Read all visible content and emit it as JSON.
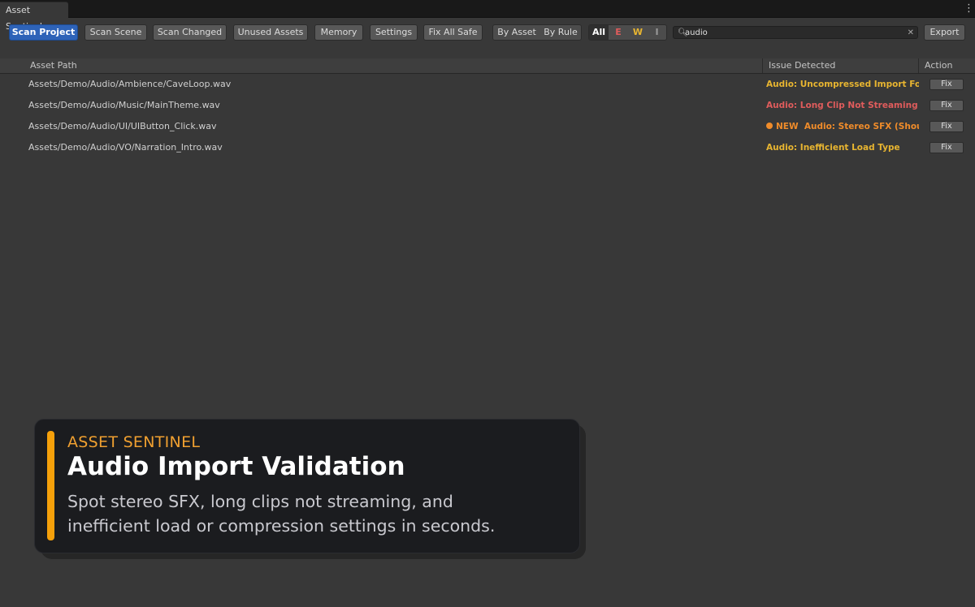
{
  "window": {
    "tab_title": "Asset Sentinel",
    "menu_icon": "kebab-menu-icon"
  },
  "toolbar": {
    "buttons": [
      {
        "label": "Scan Project",
        "active": true
      },
      {
        "label": "Scan Scene"
      },
      {
        "label": "Scan Changed"
      },
      {
        "label": "Unused Assets"
      },
      {
        "label": "Memory"
      },
      {
        "label": "Settings"
      },
      {
        "label": "Fix All Safe"
      }
    ],
    "grouping": [
      "By Asset",
      "By Rule"
    ],
    "severity": [
      "All",
      "E",
      "W",
      "I"
    ],
    "search": {
      "value": "audio",
      "icon": "search-icon",
      "clear_icon": "close-icon"
    },
    "export_label": "Export"
  },
  "table": {
    "columns": [
      "Asset Path",
      "Issue Detected",
      "Action"
    ],
    "rows": [
      {
        "path": "Assets/Demo/Audio/Ambience/CaveLoop.wav",
        "issue": "Audio: Uncompressed Import Format",
        "color": "#e8b530",
        "action": "Fix"
      },
      {
        "path": "Assets/Demo/Audio/Music/MainTheme.wav",
        "issue": "Audio: Long Clip Not Streaming",
        "color": "#e05c5c",
        "action": "Fix"
      },
      {
        "path": "Assets/Demo/Audio/UI/UIButton_Click.wav",
        "badge": "NEW",
        "issue": "Audio: Stereo SFX (Should Be Mono)",
        "color": "#f08c2a",
        "action": "Fix"
      },
      {
        "path": "Assets/Demo/Audio/VO/Narration_Intro.wav",
        "issue": "Audio: Inefficient Load Type",
        "color": "#e8b530",
        "action": "Fix"
      }
    ]
  },
  "callout": {
    "kicker": "ASSET SENTINEL",
    "title": "Audio Import Validation",
    "body": "Spot stereo SFX, long clips not streaming, and inefficient load or compression settings in seconds."
  },
  "colors": {
    "accent": "#2e63b8",
    "error": "#e05c5c",
    "warning": "#e8b530",
    "new_badge": "#f08c2a",
    "callout_bar": "#f5a00a"
  }
}
